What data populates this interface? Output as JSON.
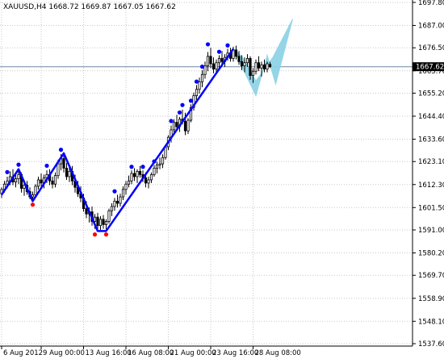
{
  "header": {
    "symbol_line": "XAUUSD,H4  1668.72 1669.87 1667.05 1667.62"
  },
  "chart_data": {
    "type": "candlestick",
    "symbol": "XAUUSD",
    "timeframe": "H4",
    "ohlc_current": {
      "open": 1668.72,
      "high": 1669.87,
      "low": 1667.05,
      "close": 1667.62
    },
    "current_price_label": "1667.62",
    "current_price": 1667.62,
    "y_axis": {
      "ylim": [
        1537.6,
        1697.8
      ],
      "tick_labels": [
        "1697.80",
        "1687.00",
        "1676.50",
        "1665.70",
        "1655.20",
        "1644.40",
        "1633.60",
        "1623.10",
        "1612.30",
        "1601.50",
        "1591.00",
        "1580.20",
        "1569.70",
        "1558.90",
        "1548.10",
        "1537.60"
      ],
      "tick_values": [
        1697.8,
        1687.0,
        1676.5,
        1665.7,
        1655.2,
        1644.4,
        1633.6,
        1623.1,
        1612.3,
        1601.5,
        1591.0,
        1580.2,
        1569.7,
        1558.9,
        1548.1,
        1537.6
      ]
    },
    "x_axis": {
      "tick_labels": [
        "6 Aug 2012",
        "9 Aug 00:00",
        "13 Aug 16:00",
        "16 Aug 08:00",
        "21 Aug 00:00",
        "23 Aug 16:00",
        "28 Aug 08:00"
      ],
      "tick_bar_index": [
        0,
        14,
        29,
        44,
        59,
        74,
        89
      ]
    },
    "bars_count": 96,
    "zigzag": {
      "color": "#0000ff",
      "points": [
        {
          "bar": 0,
          "price": 1607.5
        },
        {
          "bar": 6,
          "price": 1619.5
        },
        {
          "bar": 11,
          "price": 1604.5
        },
        {
          "bar": 22,
          "price": 1627.0
        },
        {
          "bar": 34,
          "price": 1590.5
        },
        {
          "bar": 37,
          "price": 1590.5
        },
        {
          "bar": 82,
          "price": 1676.0
        }
      ]
    },
    "projection": {
      "color": "#8fd3e6",
      "points": [
        {
          "bar": 82,
          "price": 1676.0
        },
        {
          "bar": 90,
          "price": 1654.0
        },
        {
          "bar": 94,
          "price": 1673.0
        },
        {
          "bar": 97,
          "price": 1659.5
        },
        {
          "bar": 103,
          "price": 1690.0
        },
        {
          "bar": 96,
          "price": 1672.0
        },
        {
          "bar": 92,
          "price": 1664.5
        },
        {
          "bar": 90,
          "price": 1661.0
        },
        {
          "bar": 85,
          "price": 1672.5
        }
      ]
    },
    "candles": [
      [
        1608.0,
        1611.0,
        1606.0,
        1610.0
      ],
      [
        1610.0,
        1614.0,
        1608.5,
        1612.5
      ],
      [
        1612.5,
        1616.0,
        1610.5,
        1614.0
      ],
      [
        1614.0,
        1618.5,
        1612.0,
        1616.0
      ],
      [
        1616.0,
        1619.5,
        1612.0,
        1613.5
      ],
      [
        1613.5,
        1617.0,
        1611.0,
        1615.0
      ],
      [
        1615.0,
        1619.5,
        1612.5,
        1617.0
      ],
      [
        1617.0,
        1618.0,
        1608.5,
        1610.5
      ],
      [
        1610.5,
        1614.5,
        1607.0,
        1612.0
      ],
      [
        1612.0,
        1614.0,
        1607.5,
        1609.0
      ],
      [
        1609.0,
        1611.0,
        1605.5,
        1606.5
      ],
      [
        1606.5,
        1609.0,
        1604.5,
        1607.5
      ],
      [
        1607.5,
        1612.5,
        1606.5,
        1611.5
      ],
      [
        1611.5,
        1616.0,
        1610.0,
        1614.5
      ],
      [
        1614.5,
        1617.5,
        1611.5,
        1613.0
      ],
      [
        1613.0,
        1617.0,
        1610.5,
        1615.5
      ],
      [
        1615.5,
        1619.0,
        1613.0,
        1617.0
      ],
      [
        1617.0,
        1619.5,
        1612.0,
        1614.0
      ],
      [
        1614.0,
        1616.0,
        1610.5,
        1612.5
      ],
      [
        1612.5,
        1618.0,
        1611.0,
        1616.5
      ],
      [
        1616.5,
        1624.0,
        1615.0,
        1622.0
      ],
      [
        1622.0,
        1626.5,
        1619.0,
        1624.5
      ],
      [
        1624.5,
        1627.0,
        1618.0,
        1620.0
      ],
      [
        1620.0,
        1622.5,
        1614.5,
        1616.0
      ],
      [
        1616.0,
        1620.5,
        1613.5,
        1618.5
      ],
      [
        1618.5,
        1621.0,
        1612.0,
        1614.0
      ],
      [
        1614.0,
        1617.0,
        1608.5,
        1611.0
      ],
      [
        1611.0,
        1614.0,
        1606.5,
        1608.0
      ],
      [
        1608.0,
        1611.5,
        1604.0,
        1606.0
      ],
      [
        1606.0,
        1608.0,
        1599.5,
        1601.0
      ],
      [
        1601.0,
        1604.5,
        1596.5,
        1598.5
      ],
      [
        1598.5,
        1601.5,
        1594.5,
        1599.5
      ],
      [
        1599.5,
        1602.0,
        1593.0,
        1595.0
      ],
      [
        1595.0,
        1598.5,
        1591.5,
        1597.0
      ],
      [
        1597.0,
        1599.0,
        1590.5,
        1593.0
      ],
      [
        1593.0,
        1597.5,
        1591.0,
        1596.0
      ],
      [
        1596.0,
        1598.0,
        1591.5,
        1593.5
      ],
      [
        1593.5,
        1596.0,
        1590.5,
        1595.0
      ],
      [
        1595.0,
        1601.0,
        1594.0,
        1600.0
      ],
      [
        1600.0,
        1603.5,
        1597.5,
        1602.0
      ],
      [
        1602.0,
        1606.0,
        1600.0,
        1604.5
      ],
      [
        1604.5,
        1607.5,
        1601.5,
        1603.5
      ],
      [
        1603.5,
        1608.0,
        1602.0,
        1606.5
      ],
      [
        1606.5,
        1611.5,
        1605.0,
        1610.0
      ],
      [
        1610.0,
        1614.0,
        1607.5,
        1612.5
      ],
      [
        1612.5,
        1616.5,
        1611.0,
        1614.0
      ],
      [
        1614.0,
        1619.0,
        1612.5,
        1617.5
      ],
      [
        1617.5,
        1620.0,
        1614.0,
        1616.0
      ],
      [
        1616.0,
        1619.5,
        1613.0,
        1618.5
      ],
      [
        1618.5,
        1621.0,
        1615.5,
        1617.0
      ],
      [
        1617.0,
        1619.0,
        1613.5,
        1615.5
      ],
      [
        1615.5,
        1618.0,
        1611.0,
        1613.0
      ],
      [
        1613.0,
        1616.0,
        1610.5,
        1614.5
      ],
      [
        1614.5,
        1618.0,
        1613.0,
        1617.0
      ],
      [
        1617.0,
        1621.5,
        1616.0,
        1620.0
      ],
      [
        1620.0,
        1623.0,
        1617.5,
        1621.5
      ],
      [
        1621.5,
        1625.0,
        1619.5,
        1622.0
      ],
      [
        1622.0,
        1626.5,
        1620.0,
        1625.0
      ],
      [
        1625.0,
        1631.0,
        1624.0,
        1630.0
      ],
      [
        1630.0,
        1635.5,
        1628.5,
        1634.5
      ],
      [
        1634.5,
        1640.0,
        1632.0,
        1638.0
      ],
      [
        1638.0,
        1643.0,
        1636.0,
        1641.5
      ],
      [
        1641.5,
        1645.0,
        1638.0,
        1639.5
      ],
      [
        1639.5,
        1644.0,
        1637.0,
        1643.0
      ],
      [
        1643.0,
        1647.5,
        1640.5,
        1642.0
      ],
      [
        1642.0,
        1646.0,
        1635.5,
        1637.5
      ],
      [
        1637.5,
        1643.5,
        1636.0,
        1642.5
      ],
      [
        1642.5,
        1650.0,
        1641.5,
        1648.5
      ],
      [
        1648.5,
        1655.5,
        1647.0,
        1654.0
      ],
      [
        1654.0,
        1659.0,
        1651.5,
        1657.0
      ],
      [
        1657.0,
        1662.5,
        1655.0,
        1660.5
      ],
      [
        1660.5,
        1666.0,
        1658.0,
        1664.0
      ],
      [
        1664.0,
        1670.0,
        1662.0,
        1668.0
      ],
      [
        1668.0,
        1674.5,
        1665.5,
        1672.5
      ],
      [
        1672.5,
        1676.5,
        1667.0,
        1669.0
      ],
      [
        1669.0,
        1672.0,
        1664.5,
        1666.5
      ],
      [
        1666.5,
        1671.0,
        1665.0,
        1669.5
      ],
      [
        1669.5,
        1673.0,
        1666.0,
        1671.5
      ],
      [
        1671.5,
        1675.0,
        1668.5,
        1670.0
      ],
      [
        1670.0,
        1673.5,
        1667.5,
        1672.0
      ],
      [
        1672.0,
        1676.0,
        1670.5,
        1674.0
      ],
      [
        1674.0,
        1676.5,
        1670.0,
        1671.5
      ],
      [
        1671.5,
        1677.0,
        1670.0,
        1675.5
      ],
      [
        1675.5,
        1677.5,
        1671.0,
        1672.5
      ],
      [
        1672.5,
        1675.0,
        1668.5,
        1670.0
      ],
      [
        1670.0,
        1673.0,
        1666.0,
        1668.0
      ],
      [
        1668.0,
        1672.0,
        1665.0,
        1669.5
      ],
      [
        1669.5,
        1673.5,
        1667.5,
        1671.5
      ],
      [
        1671.5,
        1672.5,
        1661.5,
        1663.5
      ],
      [
        1663.5,
        1667.0,
        1660.0,
        1665.5
      ],
      [
        1665.5,
        1671.0,
        1664.0,
        1669.5
      ],
      [
        1669.5,
        1672.5,
        1665.5,
        1667.0
      ],
      [
        1667.0,
        1670.0,
        1663.0,
        1668.5
      ],
      [
        1668.5,
        1671.0,
        1665.0,
        1666.5
      ],
      [
        1666.5,
        1670.0,
        1665.0,
        1669.0
      ],
      [
        1668.72,
        1669.87,
        1667.05,
        1667.62
      ]
    ],
    "fractal_highs": [
      {
        "bar": 2,
        "price": 1617.0
      },
      {
        "bar": 6,
        "price": 1620.5
      },
      {
        "bar": 16,
        "price": 1620.0
      },
      {
        "bar": 21,
        "price": 1627.5
      },
      {
        "bar": 40,
        "price": 1608.0
      },
      {
        "bar": 46,
        "price": 1619.5
      },
      {
        "bar": 50,
        "price": 1619.5
      },
      {
        "bar": 54,
        "price": 1622.0
      },
      {
        "bar": 60,
        "price": 1641.0
      },
      {
        "bar": 63,
        "price": 1645.0
      },
      {
        "bar": 64,
        "price": 1648.5
      },
      {
        "bar": 67,
        "price": 1650.5
      },
      {
        "bar": 69,
        "price": 1659.5
      },
      {
        "bar": 71,
        "price": 1666.5
      },
      {
        "bar": 73,
        "price": 1677.0
      },
      {
        "bar": 77,
        "price": 1673.5
      },
      {
        "bar": 80,
        "price": 1676.5
      }
    ],
    "fractal_lows": [
      {
        "bar": 11,
        "price": 1604.0
      },
      {
        "bar": 33,
        "price": 1590.0
      },
      {
        "bar": 37,
        "price": 1590.0
      }
    ]
  }
}
